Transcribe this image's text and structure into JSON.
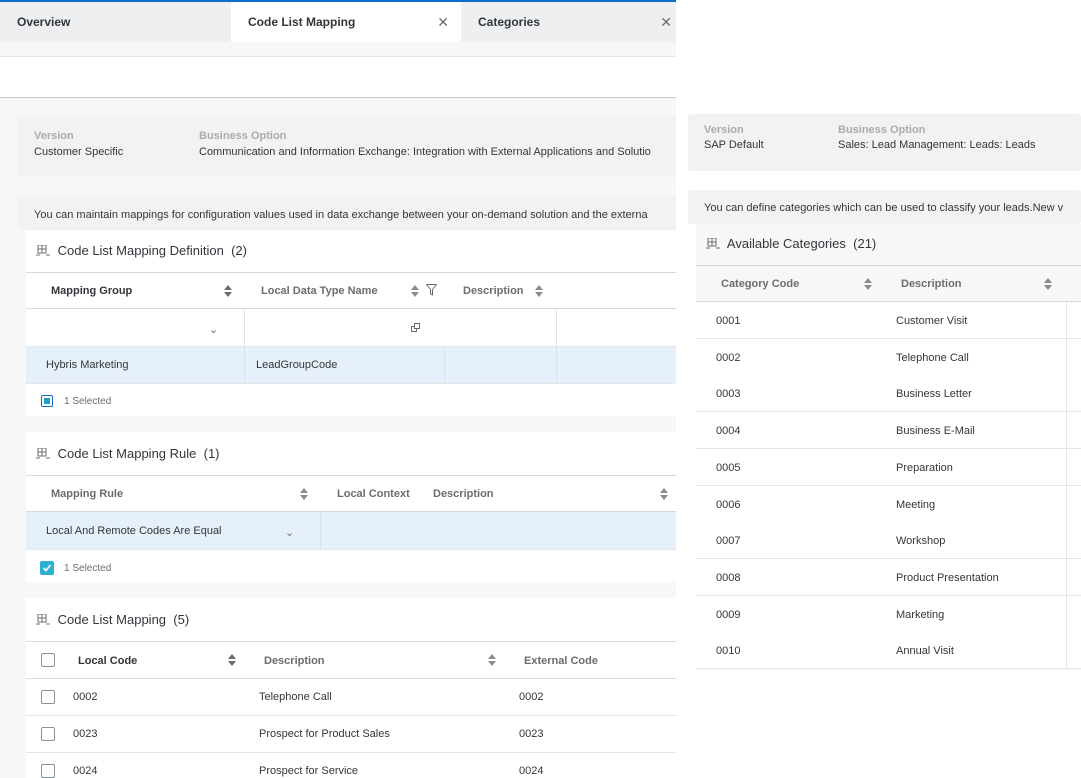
{
  "tabs": [
    {
      "label": "Overview",
      "active": false,
      "closable": false
    },
    {
      "label": "Code List Mapping",
      "active": true,
      "closable": true
    },
    {
      "label": "Categories",
      "active": false,
      "closable": true
    }
  ],
  "left": {
    "info": {
      "version_label": "Version",
      "version_value": "Customer Specific",
      "option_label": "Business Option",
      "option_value": "Communication and Information Exchange: Integration with External Applications and Solutio"
    },
    "message": "You can maintain mappings for configuration values used in data exchange between your on-demand solution and the externa",
    "definition": {
      "title": "Code List Mapping Definition",
      "count": "(2)",
      "columns": [
        "Mapping Group",
        "Local Data Type Name",
        "Description"
      ],
      "rows": [
        {
          "mapping_group": "Hybris Marketing",
          "local_data_type": "LeadGroupCode",
          "description": ""
        }
      ],
      "selected_text": "1 Selected"
    },
    "rule": {
      "title": "Code List Mapping Rule",
      "count": "(1)",
      "columns": [
        "Mapping Rule",
        "Local Context",
        "Description"
      ],
      "rows": [
        {
          "mapping_rule": "Local And Remote Codes Are Equal",
          "local_context": "",
          "description": ""
        }
      ],
      "selected_text": "1 Selected"
    },
    "mapping": {
      "title": "Code List Mapping",
      "count": "(5)",
      "columns": [
        "Local Code",
        "Description",
        "External Code"
      ],
      "rows": [
        {
          "local_code": "0002",
          "description": "Telephone Call",
          "external_code": "0002"
        },
        {
          "local_code": "0023",
          "description": "Prospect for Product Sales",
          "external_code": "0023"
        },
        {
          "local_code": "0024",
          "description": "Prospect for Service",
          "external_code": "0024"
        }
      ]
    }
  },
  "right": {
    "info": {
      "version_label": "Version",
      "version_value": "SAP Default",
      "option_label": "Business Option",
      "option_value": "Sales: Lead Management: Leads: Leads"
    },
    "message": "You can define categories which can be used to classify your leads.New v",
    "categories": {
      "title": "Available Categories",
      "count": "(21)",
      "columns": [
        "Category Code",
        "Description"
      ],
      "rows": [
        {
          "code": "0001",
          "description": "Customer Visit"
        },
        {
          "code": "0002",
          "description": "Telephone Call"
        },
        {
          "code": "0003",
          "description": "Business Letter"
        },
        {
          "code": "0004",
          "description": "Business E-Mail"
        },
        {
          "code": "0005",
          "description": "Preparation"
        },
        {
          "code": "0006",
          "description": "Meeting"
        },
        {
          "code": "0007",
          "description": "Workshop"
        },
        {
          "code": "0008",
          "description": "Product Presentation"
        },
        {
          "code": "0009",
          "description": "Marketing"
        },
        {
          "code": "0010",
          "description": "Annual Visit"
        }
      ]
    }
  },
  "colors": {
    "accent": "#0a6ed1",
    "selected_row": "#e5f0fa",
    "checkbox_checked": "#2db0d1"
  }
}
